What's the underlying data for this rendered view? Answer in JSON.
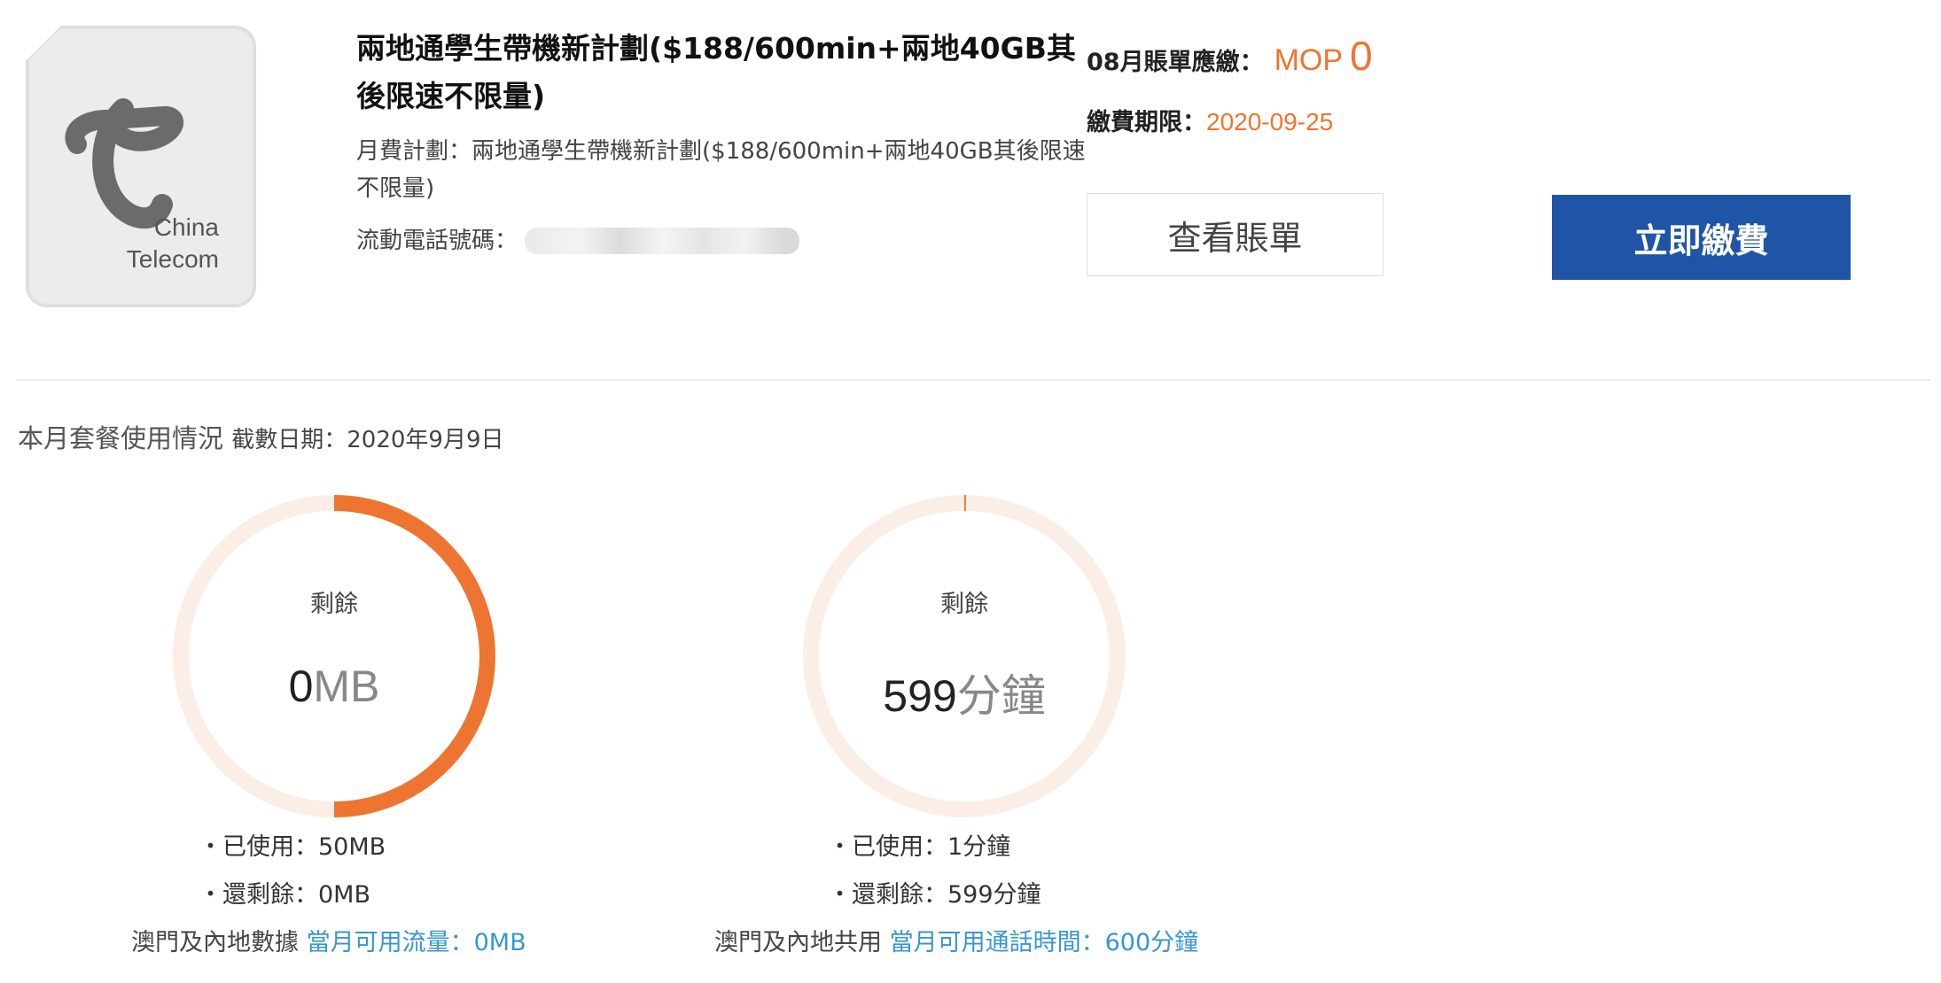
{
  "logo": {
    "line1": "China",
    "line2": "Telecom",
    "icon": "china-telecom-logo-icon"
  },
  "plan": {
    "title": "兩地通學生帶機新計劃($188/600min+兩地40GB其後限速不限量)",
    "desc_label": "月費計劃：",
    "desc_value": "兩地通學生帶機新計劃($188/600min+兩地40GB其後限速不限量)",
    "phone_label": "流動電話號碼："
  },
  "bill": {
    "label": "08月賬單應繳：",
    "currency": "MOP",
    "amount": "0",
    "due_label": "繳費期限：",
    "due_date": "2020-09-25",
    "view_button": "查看賬單",
    "pay_button": "立即繳費"
  },
  "usage": {
    "heading": "本月套餐使用情況",
    "cutoff": "截數日期：2020年9月9日",
    "data": {
      "remain_label": "剩餘",
      "remain_value": "0",
      "remain_unit": "MB",
      "used_fraction": 1.0,
      "used": "・已使用：50MB",
      "left": "・還剩餘：0MB",
      "note": "澳門及內地數據",
      "note_highlight": "當月可用流量：0MB"
    },
    "voice": {
      "remain_label": "剩餘",
      "remain_value": "599",
      "remain_unit": "分鐘",
      "used_fraction": 0.0017,
      "used": "・已使用：1分鐘",
      "left": "・還剩餘：599分鐘",
      "note": "澳門及內地共用",
      "note_highlight": "當月可用通話時間：600分鐘"
    }
  },
  "colors": {
    "accent": "#ee7531",
    "ring_bg": "#fbeee6",
    "primary": "#1f55a6",
    "link": "#3796d3"
  }
}
